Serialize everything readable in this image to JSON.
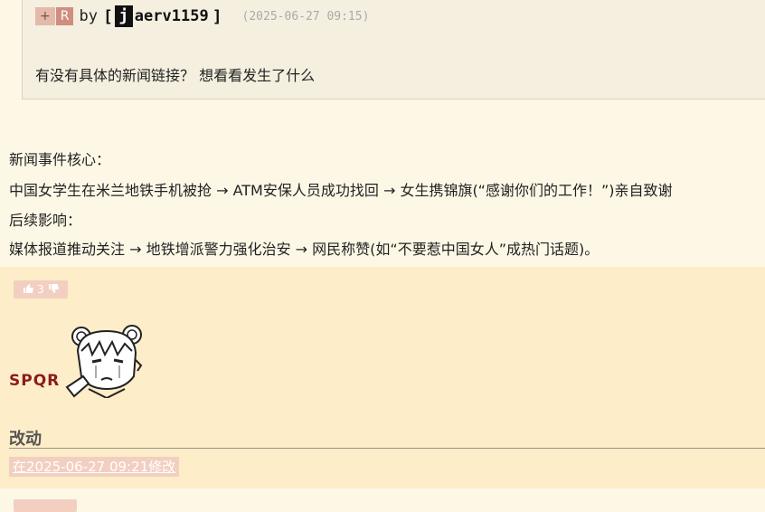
{
  "quote": {
    "plus": "+",
    "r": "R",
    "by": "by",
    "bracket_open": "[",
    "bracket_close": "]",
    "j_letter": "j",
    "username": "aerv1159",
    "time": "(2025-06-27 09:15)",
    "text": "有没有具体的新闻链接？ 想看看发生了什么"
  },
  "body": {
    "lines": [
      "新闻事件核心：",
      "中国女学生在米兰地铁手机被抢 → ATM安保人员成功找回 → 女生携锦旗(“感谢你们的工作！”)亲自致谢",
      "后续影响：",
      "媒体报道推动关注 → 地铁增派警力强化治安 → 网民称赞(如“不要惹中国女人”成热门话题)。"
    ]
  },
  "post2": {
    "vote_count": "3",
    "username": "SPQR",
    "title": "改动",
    "edit_note": "在2025-06-27 09:21修改"
  },
  "colors": {
    "page_bg": "#fdf8e6",
    "post_bg": "#fdedc8",
    "username_red": "#8a1c1c",
    "badge_pink": "#f2cfc0"
  }
}
